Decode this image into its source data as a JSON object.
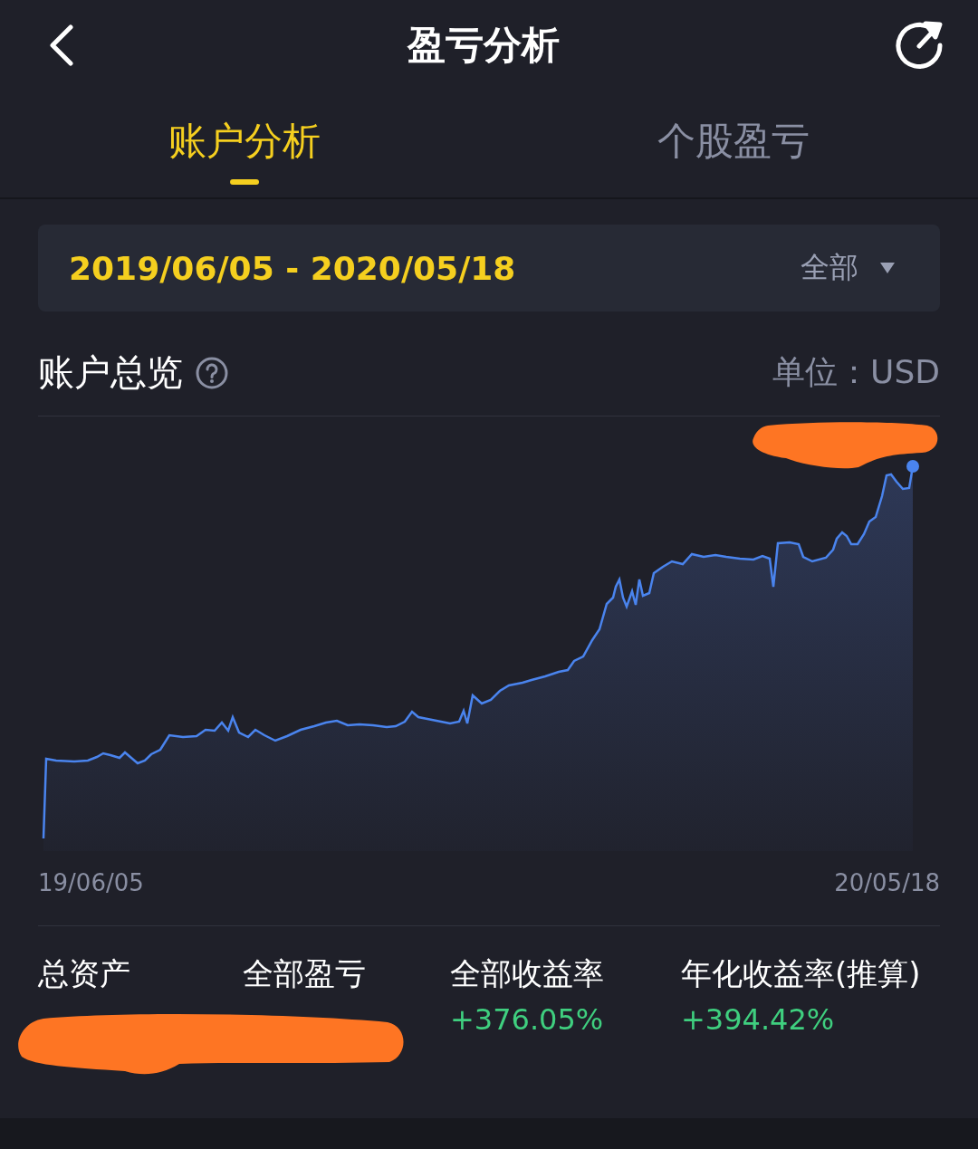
{
  "header": {
    "title": "盈亏分析"
  },
  "tabs": [
    {
      "label": "账户分析",
      "selected": true
    },
    {
      "label": "个股盈亏",
      "selected": false
    }
  ],
  "date_range": {
    "value": "2019/06/05 - 2020/05/18",
    "filter": "全部"
  },
  "overview": {
    "title": "账户总览",
    "unit": "单位：USD",
    "x_start": "19/06/05",
    "x_end": "20/05/18"
  },
  "stats": [
    {
      "label": "总资产"
    },
    {
      "label": "全部盈亏"
    },
    {
      "label": "全部收益率",
      "value": "+376.05%"
    },
    {
      "label": "年化收益率(推算)",
      "value": "+394.42%"
    }
  ]
}
